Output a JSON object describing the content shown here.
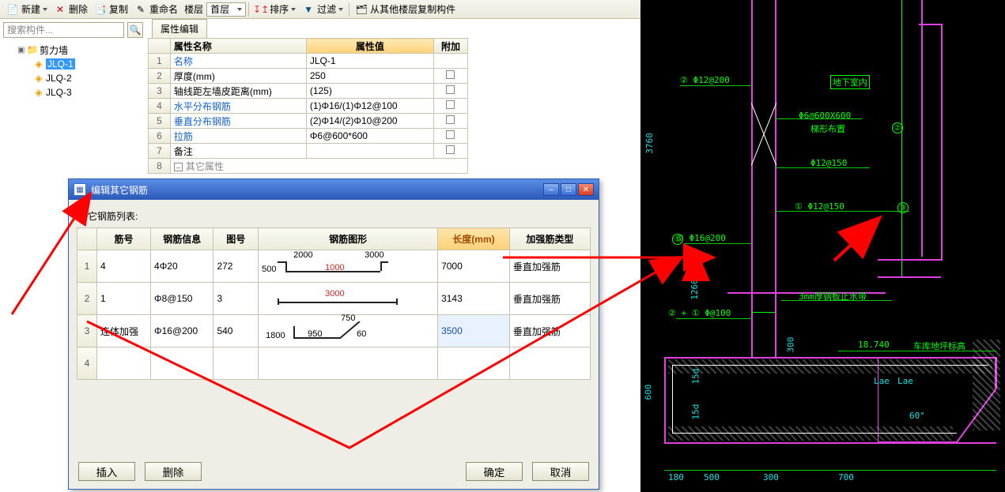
{
  "toolbar": {
    "new": "新建",
    "delete": "删除",
    "copy": "复制",
    "rename": "重命名",
    "floor_lbl": "楼层",
    "floor_val": "首层",
    "sort": "排序",
    "filter": "过滤",
    "copy_from": "从其他楼层复制构件"
  },
  "search": {
    "placeholder": "搜索构件..."
  },
  "tree": {
    "root": "剪力墙",
    "items": [
      "JLQ-1",
      "JLQ-2",
      "JLQ-3"
    ],
    "selected_index": 0
  },
  "prop": {
    "tab": "属性编辑",
    "head_name": "属性名称",
    "head_val": "属性值",
    "head_extra": "附加",
    "rows": [
      {
        "n": "1",
        "name": "名称",
        "link": true,
        "val": "JLQ-1",
        "chk": false
      },
      {
        "n": "2",
        "name": "厚度(mm)",
        "link": false,
        "val": "250",
        "chk": true
      },
      {
        "n": "3",
        "name": "轴线距左墙皮距离(mm)",
        "link": false,
        "val": "(125)",
        "chk": true
      },
      {
        "n": "4",
        "name": "水平分布钢筋",
        "link": true,
        "val": "(1)Φ16/(1)Φ12@100",
        "chk": true
      },
      {
        "n": "5",
        "name": "垂直分布钢筋",
        "link": true,
        "val": "(2)Φ14/(2)Φ10@200",
        "chk": true
      },
      {
        "n": "6",
        "name": "拉筋",
        "link": true,
        "val": "Φ6@600*600",
        "chk": true
      },
      {
        "n": "7",
        "name": "备注",
        "link": false,
        "val": "",
        "chk": true
      },
      {
        "n": "8",
        "name": "其它属性",
        "link": false,
        "val": "",
        "chk": false,
        "group": true
      }
    ]
  },
  "dlg": {
    "title": "编辑其它钢筋",
    "subtitle": "其它钢筋列表:",
    "heads": {
      "id": "筋号",
      "info": "钢筋信息",
      "pic": "图号",
      "shape": "钢筋图形",
      "len": "长度(mm)",
      "type": "加强筋类型"
    },
    "rows": [
      {
        "n": "1",
        "id": "4",
        "info": "4Φ20",
        "pic": "272",
        "len": "7000",
        "type": "垂直加强筋",
        "shape": {
          "kind": "u",
          "top_l": "2000",
          "top_r": "3000",
          "mid": "1000",
          "left": "500"
        }
      },
      {
        "n": "2",
        "id": "1",
        "info": "Φ8@150",
        "pic": "3",
        "len": "3143",
        "type": "垂直加强筋",
        "shape": {
          "kind": "flat",
          "mid": "3000"
        }
      },
      {
        "n": "3",
        "id": "连体加强",
        "info": "Φ16@200",
        "pic": "540",
        "len": "3500",
        "type": "垂直加强筋",
        "shape": {
          "kind": "l",
          "left": "1800",
          "mid": "950",
          "top": "750",
          "ang": "60"
        },
        "len_sel": true
      },
      {
        "n": "4",
        "id": "",
        "info": "",
        "pic": "",
        "len": "",
        "type": "",
        "shape": {
          "kind": "empty"
        }
      }
    ],
    "btn_insert": "插入",
    "btn_delete": "删除",
    "btn_ok": "确定",
    "btn_cancel": "取消"
  },
  "cad": {
    "notes": {
      "a": "② Φ12@200",
      "b": "Φ6@600X600",
      "b2": "梯形布置",
      "c": "Φ12@150",
      "d": "① Φ12@150",
      "e": "① Φ16@200",
      "f": "② + ① Φ@100",
      "g": "3mm厚钢板止水带",
      "h": "18.740",
      "h2": "车库地坪标高",
      "box": "地下室内"
    },
    "circled": {
      "c1": "①",
      "c2": "②",
      "c3": "③"
    },
    "dims": {
      "v_top": "3760",
      "v_mid": "1260",
      "v_bot": "600",
      "v_15d_a": "15d",
      "v_15d_b": "15d",
      "v_300": "300",
      "h_180": "180",
      "h_500": "500",
      "h_300": "300",
      "h_700": "700",
      "lae_a": "Lae",
      "lae_b": "Lae",
      "ang": "60°"
    }
  }
}
